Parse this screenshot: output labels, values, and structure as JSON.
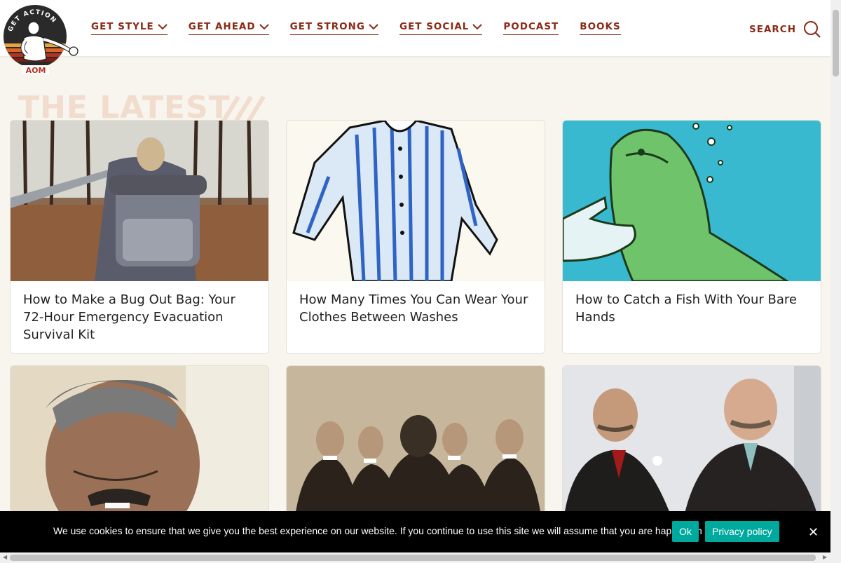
{
  "logo": {
    "arc_text": "GET ACTION",
    "letters": "AOM"
  },
  "nav": {
    "items": [
      {
        "label": "GET STYLE",
        "dropdown": true
      },
      {
        "label": "GET AHEAD",
        "dropdown": true
      },
      {
        "label": "GET STRONG",
        "dropdown": true
      },
      {
        "label": "GET SOCIAL",
        "dropdown": true
      },
      {
        "label": "PODCAST",
        "dropdown": false
      },
      {
        "label": "BOOKS",
        "dropdown": false
      }
    ],
    "search_label": "SEARCH"
  },
  "section": {
    "title": "THE LATEST"
  },
  "cards": [
    {
      "title": "How to Make a Bug Out Bag: Your 72-Hour Emergency Evacuation Survival Kit",
      "image": "man-with-backpack-in-woods"
    },
    {
      "title": "How Many Times You Can Wear Your Clothes Between Washes",
      "image": "striped-shirt-illustration"
    },
    {
      "title": "How to Catch a Fish With Your Bare Hands",
      "image": "hand-and-fish-illustration"
    },
    {
      "title": "",
      "image": "man-sleeping-with-mouth-tape"
    },
    {
      "title": "",
      "image": "vintage-men-with-mustaches"
    },
    {
      "title": "",
      "image": "roosevelt-and-taft"
    }
  ],
  "cookie": {
    "message": "We use cookies to ensure that we give you the best experience on our website. If you continue to use this site we will assume that you are happy with it.",
    "ok_label": "Ok",
    "privacy_label": "Privacy policy",
    "close_label": "✕"
  },
  "colors": {
    "brand": "#8b2a16",
    "accent": "#00a99d",
    "background": "#f7f5ee"
  }
}
